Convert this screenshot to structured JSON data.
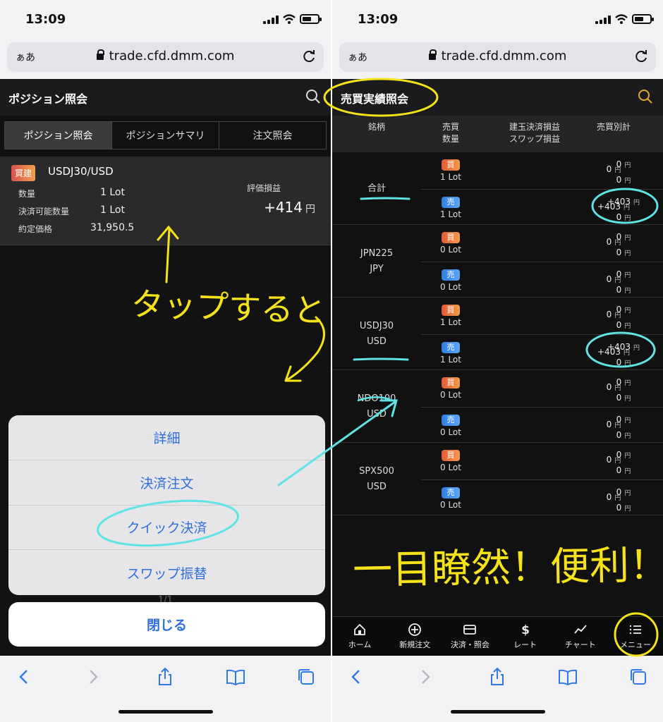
{
  "status": {
    "time": "13:09"
  },
  "browser": {
    "aa_label": "ぁあ",
    "url": "trade.cfd.dmm.com"
  },
  "left": {
    "title": "ポジション照会",
    "tabs": [
      "ポジション照会",
      "ポジションサマリ",
      "注文照会"
    ],
    "position": {
      "side_badge": "買建",
      "pair": "USDJ30/USD",
      "rows": [
        {
          "label": "数量",
          "value": "1 Lot"
        },
        {
          "label": "決済可能数量",
          "value": "1 Lot"
        },
        {
          "label": "約定価格",
          "value": "31,950.5"
        }
      ],
      "pl_label": "評価損益",
      "pl_value": "+414",
      "pl_unit": "円"
    },
    "sheet": {
      "items": [
        "詳細",
        "決済注文",
        "クイック決済",
        "スワップ振替"
      ],
      "pager": "1/1",
      "close": "閉じる"
    }
  },
  "right": {
    "title": "売買実績照会",
    "headers": {
      "symbol": "銘柄",
      "side_qty": [
        "売買",
        "数量"
      ],
      "pl": [
        "建玉決済損益",
        "スワップ損益"
      ],
      "total": "売買別計"
    },
    "yen": "円",
    "groups": [
      {
        "symbol": [
          "合計"
        ],
        "rows": [
          {
            "side": "買",
            "side_type": "buy",
            "lot": "1 Lot",
            "pl": "0",
            "swap": "0",
            "total": "0"
          },
          {
            "side": "売",
            "side_type": "sell",
            "lot": "1 Lot",
            "pl": "+403",
            "swap": "0",
            "total": "+403"
          }
        ]
      },
      {
        "symbol": [
          "JPN225",
          "JPY"
        ],
        "rows": [
          {
            "side": "買",
            "side_type": "buy",
            "lot": "0 Lot",
            "pl": "0",
            "swap": "0",
            "total": "0"
          },
          {
            "side": "売",
            "side_type": "sell",
            "lot": "0 Lot",
            "pl": "0",
            "swap": "0",
            "total": "0"
          }
        ]
      },
      {
        "symbol": [
          "USDJ30",
          "USD"
        ],
        "rows": [
          {
            "side": "買",
            "side_type": "buy",
            "lot": "1 Lot",
            "pl": "0",
            "swap": "0",
            "total": "0"
          },
          {
            "side": "売",
            "side_type": "sell",
            "lot": "1 Lot",
            "pl": "+403",
            "swap": "0",
            "total": "+403"
          }
        ]
      },
      {
        "symbol": [
          "NDO100",
          "USD"
        ],
        "rows": [
          {
            "side": "買",
            "side_type": "buy",
            "lot": "0 Lot",
            "pl": "0",
            "swap": "0",
            "total": "0"
          },
          {
            "side": "売",
            "side_type": "sell",
            "lot": "0 Lot",
            "pl": "0",
            "swap": "0",
            "total": "0"
          }
        ]
      },
      {
        "symbol": [
          "SPX500",
          "USD"
        ],
        "rows": [
          {
            "side": "買",
            "side_type": "buy",
            "lot": "0 Lot",
            "pl": "0",
            "swap": "0",
            "total": "0"
          },
          {
            "side": "売",
            "side_type": "sell",
            "lot": "0 Lot",
            "pl": "0",
            "swap": "0",
            "total": "0"
          }
        ]
      }
    ],
    "nav": [
      {
        "label": "ホーム",
        "icon": "home-icon"
      },
      {
        "label": "新規注文",
        "icon": "plus-circle-icon"
      },
      {
        "label": "決済・照会",
        "icon": "card-icon"
      },
      {
        "label": "レート",
        "icon": "dollar-icon"
      },
      {
        "label": "チャート",
        "icon": "chart-icon"
      },
      {
        "label": "メニュー",
        "icon": "list-icon"
      }
    ]
  },
  "annotations": {
    "tap_note": "タップすると",
    "conclusion": "一目瞭然！便利！",
    "colors": {
      "yellow": "#f5e21a",
      "cyan": "#5fe3e6"
    }
  },
  "colors": {
    "link_blue": "#2f6fdc",
    "search_accent": "#e0a82e"
  }
}
